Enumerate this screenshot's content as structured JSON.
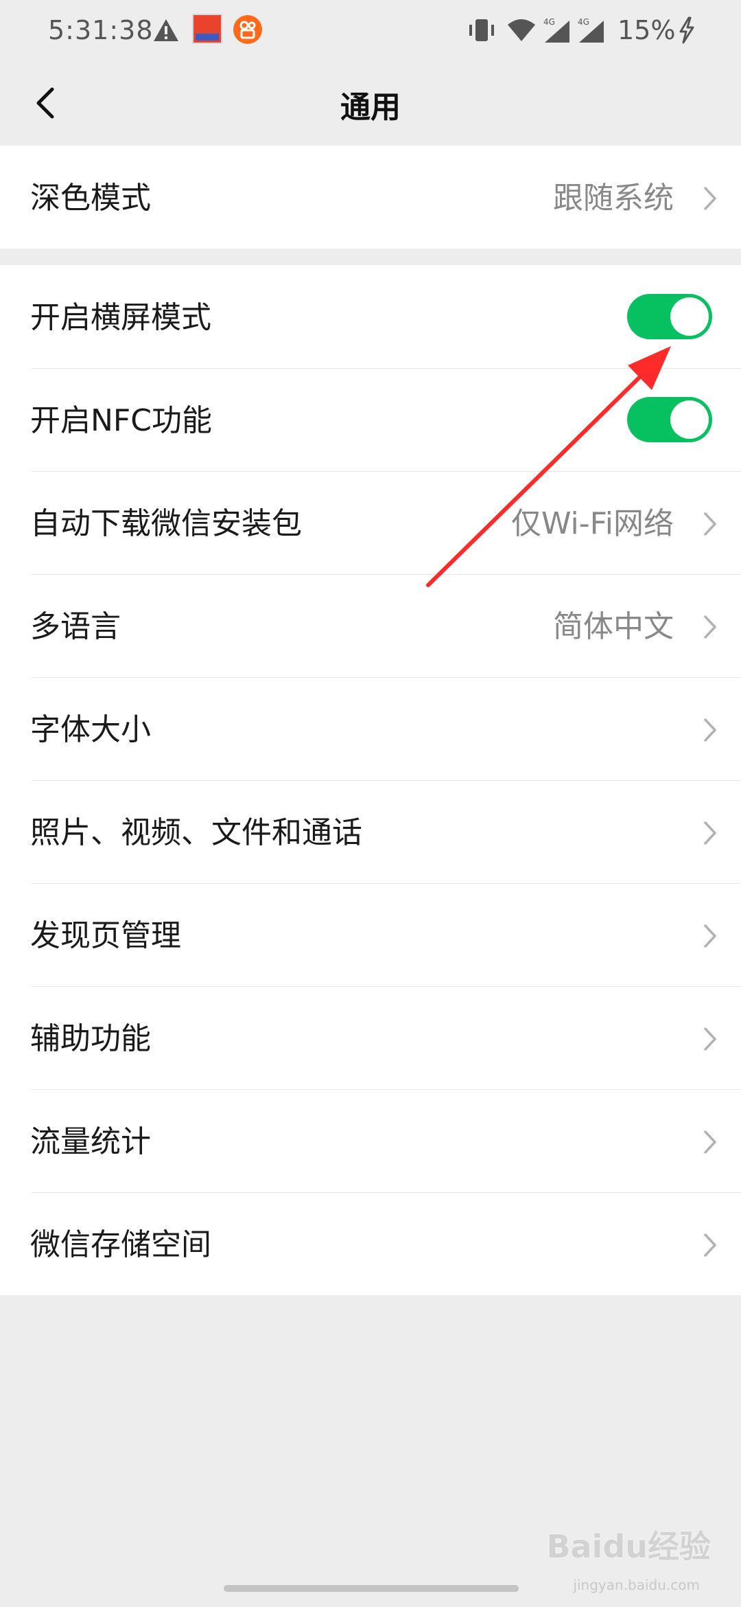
{
  "status_bar": {
    "time": "5:31:38",
    "battery": "15%",
    "network_labels": [
      "4G",
      "4G"
    ],
    "icons": [
      "warning-icon",
      "app-badge-icon",
      "kuaishou-icon",
      "vibrate-icon",
      "wifi-icon",
      "signal-icon",
      "signal-icon",
      "charging-icon"
    ]
  },
  "nav": {
    "title": "通用",
    "back_icon": "chevron-left-icon"
  },
  "groups": [
    {
      "rows": [
        {
          "label": "深色模式",
          "value": "跟随系统",
          "type": "link"
        }
      ]
    },
    {
      "rows": [
        {
          "label": "开启横屏模式",
          "type": "toggle",
          "on": true
        },
        {
          "label": "开启NFC功能",
          "type": "toggle",
          "on": true
        },
        {
          "label": "自动下载微信安装包",
          "value": "仅Wi-Fi网络",
          "type": "link"
        },
        {
          "label": "多语言",
          "value": "简体中文",
          "type": "link"
        },
        {
          "label": "字体大小",
          "type": "link"
        },
        {
          "label": "照片、视频、文件和通话",
          "type": "link"
        },
        {
          "label": "发现页管理",
          "type": "link"
        },
        {
          "label": "辅助功能",
          "type": "link"
        },
        {
          "label": "流量统计",
          "type": "link"
        },
        {
          "label": "微信存储空间",
          "type": "link"
        }
      ]
    }
  ],
  "watermark": {
    "brand": "Baidu经验",
    "url": "jingyan.baidu.com"
  },
  "colors": {
    "background": "#ededed",
    "toggle_on": "#07c160",
    "annotation_arrow": "#ff2a2a",
    "secondary_text": "#888888"
  }
}
